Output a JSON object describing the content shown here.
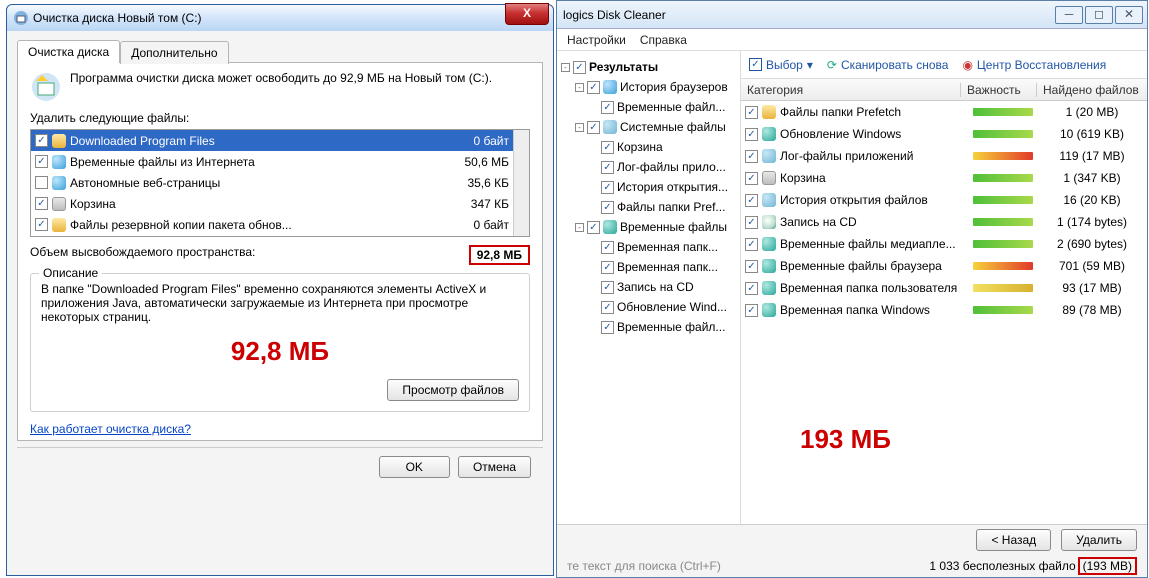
{
  "w1": {
    "title": "Очистка диска Новый том (C:)",
    "tabs": [
      "Очистка диска",
      "Дополнительно"
    ],
    "intro": "Программа очистки диска может освободить до 92,9 МБ на Новый том (C:).",
    "delete_label": "Удалить следующие файлы:",
    "files": [
      {
        "chk": true,
        "name": "Downloaded Program Files",
        "size": "0 байт",
        "sel": true,
        "ic": "ic-fold"
      },
      {
        "chk": true,
        "name": "Временные файлы из Интернета",
        "size": "50,6 МБ",
        "ic": "ic-globe"
      },
      {
        "chk": false,
        "name": "Автономные веб-страницы",
        "size": "35,6 КБ",
        "ic": "ic-globe"
      },
      {
        "chk": true,
        "name": "Корзина",
        "size": "347 КБ",
        "ic": "ic-bin"
      },
      {
        "chk": true,
        "name": "Файлы резервной копии пакета обнов...",
        "size": "0 байт",
        "ic": "ic-fold"
      }
    ],
    "total_label": "Объем высвобождаемого пространства:",
    "total_val": "92,8 МБ",
    "desc_title": "Описание",
    "desc": "В папке \"Downloaded Program Files\" временно сохраняются элементы ActiveX и приложения Java, автоматически загружаемые из Интернета при просмотре некоторых страниц.",
    "big": "92,8 МБ",
    "view_btn": "Просмотр файлов",
    "link": "Как работает очистка диска?",
    "ok": "OK",
    "cancel": "Отмена"
  },
  "w2": {
    "title": "logics Disk Cleaner",
    "menu": [
      "Настройки",
      "Справка"
    ],
    "tree": [
      {
        "d": 0,
        "tog": "-",
        "chk": true,
        "name": "Результаты",
        "bold": true
      },
      {
        "d": 1,
        "tog": "-",
        "chk": true,
        "ic": "ic-globe",
        "name": "История браузеров"
      },
      {
        "d": 2,
        "chk": true,
        "name": "Временные файл..."
      },
      {
        "d": 1,
        "tog": "-",
        "chk": true,
        "ic": "ic-sys",
        "name": "Системные файлы"
      },
      {
        "d": 2,
        "chk": true,
        "name": "Корзина"
      },
      {
        "d": 2,
        "chk": true,
        "name": "Лог-файлы прило..."
      },
      {
        "d": 2,
        "chk": true,
        "name": "История открытия..."
      },
      {
        "d": 2,
        "chk": true,
        "name": "Файлы папки Pref..."
      },
      {
        "d": 1,
        "tog": "-",
        "chk": true,
        "ic": "ic-tmp",
        "name": "Временные файлы"
      },
      {
        "d": 2,
        "chk": true,
        "name": "Временная папк..."
      },
      {
        "d": 2,
        "chk": true,
        "name": "Временная папк..."
      },
      {
        "d": 2,
        "chk": true,
        "name": "Запись на CD"
      },
      {
        "d": 2,
        "chk": true,
        "name": "Обновление Wind..."
      },
      {
        "d": 2,
        "chk": true,
        "name": "Временные файл..."
      }
    ],
    "toolbar": {
      "select": "Выбор",
      "scan": "Сканировать снова",
      "restore": "Центр Восстановления"
    },
    "cols": [
      "Категория",
      "Важность",
      "Найдено файлов"
    ],
    "rows": [
      {
        "ic": "ic-fold",
        "name": "Файлы папки Prefetch",
        "bar": "linear-gradient(90deg,#4fbf3a,#a9d94a)",
        "cnt": "1 (20 MB)"
      },
      {
        "ic": "ic-tmp",
        "name": "Обновление Windows",
        "bar": "linear-gradient(90deg,#4fbf3a,#a9d94a)",
        "cnt": "10 (619 KB)"
      },
      {
        "ic": "ic-sys",
        "name": "Лог-файлы приложений",
        "bar": "linear-gradient(90deg,#f7d23a,#e03a2a)",
        "cnt": "119 (17 MB)"
      },
      {
        "ic": "ic-bin",
        "name": "Корзина",
        "bar": "linear-gradient(90deg,#4fbf3a,#a9d94a)",
        "cnt": "1 (347 KB)"
      },
      {
        "ic": "ic-sys",
        "name": "История открытия файлов",
        "bar": "linear-gradient(90deg,#4fbf3a,#a9d94a)",
        "cnt": "16 (20 KB)"
      },
      {
        "ic": "ic-cd",
        "name": "Запись на CD",
        "bar": "linear-gradient(90deg,#4fbf3a,#a9d94a)",
        "cnt": "1 (174 bytes)"
      },
      {
        "ic": "ic-tmp",
        "name": "Временные файлы медиапле...",
        "bar": "linear-gradient(90deg,#4fbf3a,#a9d94a)",
        "cnt": "2 (690 bytes)"
      },
      {
        "ic": "ic-tmp",
        "name": "Временные файлы браузера",
        "bar": "linear-gradient(90deg,#f7d23a,#e03a2a)",
        "cnt": "701 (59 MB)"
      },
      {
        "ic": "ic-tmp",
        "name": "Временная папка пользователя",
        "bar": "linear-gradient(90deg,#f2e060,#d8b030)",
        "cnt": "93 (17 MB)"
      },
      {
        "ic": "ic-tmp",
        "name": "Временная папка Windows",
        "bar": "linear-gradient(90deg,#4fbf3a,#a9d94a)",
        "cnt": "89 (78 MB)"
      }
    ],
    "big": "193 МБ",
    "back": "< Назад",
    "del": "Удалить",
    "search_ph": "те текст для поиска (Ctrl+F)",
    "status": "1 033 бесполезных файло",
    "status_sz": "(193 MB)"
  }
}
